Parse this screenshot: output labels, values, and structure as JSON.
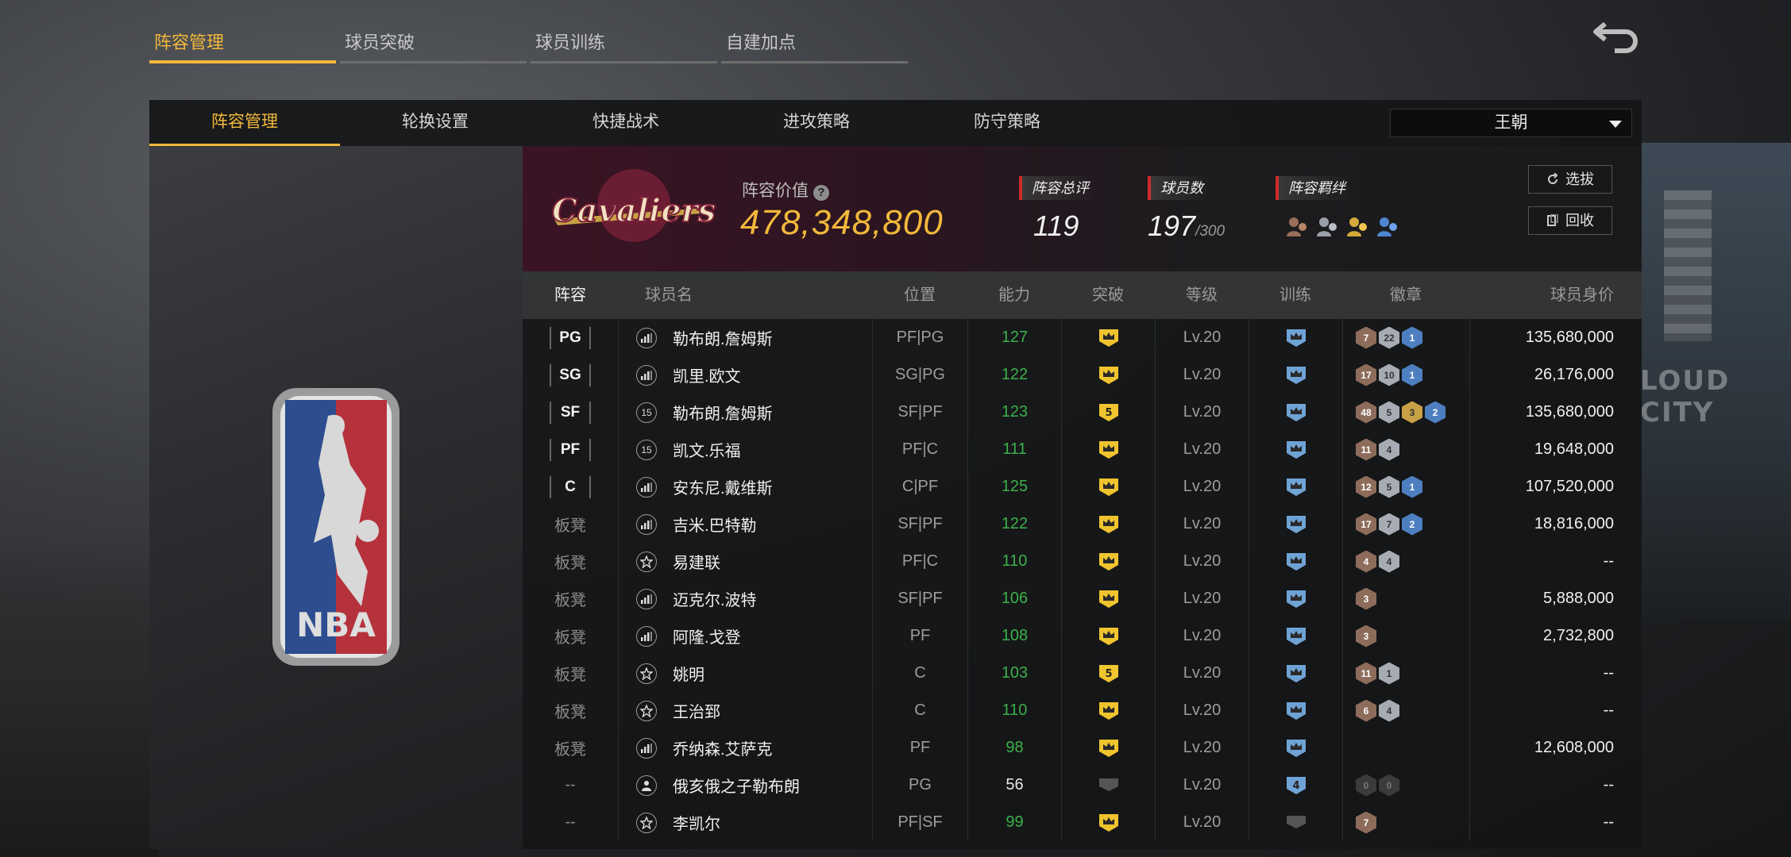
{
  "top_tabs": [
    "阵容管理",
    "球员突破",
    "球员训练",
    "自建加点"
  ],
  "sub_tabs": [
    "阵容管理",
    "轮换设置",
    "快捷战术",
    "进攻策略",
    "防守策略"
  ],
  "dynasty": "王朝",
  "team": {
    "value_label": "阵容价值",
    "value": "478,348,800",
    "overall_label": "阵容总评",
    "overall": "119",
    "player_count_label": "球员数",
    "player_count": "197",
    "player_count_max": "/300",
    "bond_label": "阵容羁绊",
    "select_btn": "选拔",
    "recycle_btn": "回收",
    "bg_right_text": "LOUD CITY"
  },
  "table": {
    "headers": [
      "阵容",
      "球员名",
      "位置",
      "能力",
      "突破",
      "等级",
      "训练",
      "徽章",
      "球员身价"
    ],
    "rows": [
      {
        "slot": "PG",
        "icon": "bars",
        "name": "勒布朗.詹姆斯",
        "pos": "PF|PG",
        "ability": "127",
        "break": "crown",
        "level": "Lv.20",
        "train": "crown",
        "badges": [
          [
            "bronze",
            "7"
          ],
          [
            "silver",
            "22"
          ],
          [
            "blue",
            "1"
          ]
        ],
        "price": "135,680,000"
      },
      {
        "slot": "SG",
        "icon": "bars",
        "name": "凯里.欧文",
        "pos": "SG|PG",
        "ability": "122",
        "break": "crown",
        "level": "Lv.20",
        "train": "crown",
        "badges": [
          [
            "bronze",
            "17"
          ],
          [
            "silver",
            "10"
          ],
          [
            "blue",
            "1"
          ]
        ],
        "price": "26,176,000"
      },
      {
        "slot": "SF",
        "icon": "15",
        "name": "勒布朗.詹姆斯",
        "pos": "SF|PF",
        "ability": "123",
        "break": "5",
        "level": "Lv.20",
        "train": "crown",
        "badges": [
          [
            "bronze",
            "48"
          ],
          [
            "silver",
            "5"
          ],
          [
            "gold",
            "3"
          ],
          [
            "blue",
            "2"
          ]
        ],
        "price": "135,680,000"
      },
      {
        "slot": "PF",
        "icon": "15",
        "name": "凯文.乐福",
        "pos": "PF|C",
        "ability": "111",
        "break": "crown",
        "level": "Lv.20",
        "train": "crown",
        "badges": [
          [
            "bronze",
            "11"
          ],
          [
            "silver",
            "4"
          ]
        ],
        "price": "19,648,000"
      },
      {
        "slot": "C",
        "icon": "bars",
        "name": "安东尼.戴维斯",
        "pos": "C|PF",
        "ability": "125",
        "break": "crown",
        "level": "Lv.20",
        "train": "crown",
        "badges": [
          [
            "bronze",
            "12"
          ],
          [
            "silver",
            "5"
          ],
          [
            "blue",
            "1"
          ]
        ],
        "price": "107,520,000"
      },
      {
        "slot": "板凳",
        "icon": "bars",
        "name": "吉米.巴特勒",
        "pos": "SF|PF",
        "ability": "122",
        "break": "crown",
        "level": "Lv.20",
        "train": "crown",
        "badges": [
          [
            "bronze",
            "17"
          ],
          [
            "silver",
            "7"
          ],
          [
            "blue",
            "2"
          ]
        ],
        "price": "18,816,000"
      },
      {
        "slot": "板凳",
        "icon": "star",
        "name": "易建联",
        "pos": "PF|C",
        "ability": "110",
        "break": "crown",
        "level": "Lv.20",
        "train": "crown",
        "badges": [
          [
            "bronze",
            "4"
          ],
          [
            "silver",
            "4"
          ]
        ],
        "price": "--"
      },
      {
        "slot": "板凳",
        "icon": "bars",
        "name": "迈克尔.波特",
        "pos": "SF|PF",
        "ability": "106",
        "break": "crown",
        "level": "Lv.20",
        "train": "crown",
        "badges": [
          [
            "bronze",
            "3"
          ]
        ],
        "price": "5,888,000"
      },
      {
        "slot": "板凳",
        "icon": "bars",
        "name": "阿隆.戈登",
        "pos": "PF",
        "ability": "108",
        "break": "crown",
        "level": "Lv.20",
        "train": "crown",
        "badges": [
          [
            "bronze",
            "3"
          ]
        ],
        "price": "2,732,800"
      },
      {
        "slot": "板凳",
        "icon": "star",
        "name": "姚明",
        "pos": "C",
        "ability": "103",
        "break": "5",
        "level": "Lv.20",
        "train": "crown",
        "badges": [
          [
            "bronze",
            "11"
          ],
          [
            "silver",
            "1"
          ]
        ],
        "price": "--"
      },
      {
        "slot": "板凳",
        "icon": "star",
        "name": "王治郅",
        "pos": "C",
        "ability": "110",
        "break": "crown",
        "level": "Lv.20",
        "train": "crown",
        "badges": [
          [
            "bronze",
            "6"
          ],
          [
            "silver",
            "4"
          ]
        ],
        "price": "--"
      },
      {
        "slot": "板凳",
        "icon": "bars",
        "name": "乔纳森.艾萨克",
        "pos": "PF",
        "ability": "98",
        "break": "crown",
        "level": "Lv.20",
        "train": "crown",
        "badges": [],
        "price": "12,608,000"
      },
      {
        "slot": "--",
        "icon": "person",
        "name": "俄亥俄之子勒布朗",
        "pos": "PG",
        "ability": "56",
        "break": "empty",
        "level": "Lv.20",
        "train": "4",
        "badges": [
          [
            "dark",
            "0"
          ],
          [
            "dark",
            "0"
          ]
        ],
        "price": "--"
      },
      {
        "slot": "--",
        "icon": "star",
        "name": "李凯尔",
        "pos": "PF|SF",
        "ability": "99",
        "break": "crown",
        "level": "Lv.20",
        "train": "empty",
        "badges": [
          [
            "bronze",
            "7"
          ]
        ],
        "price": "--"
      }
    ]
  },
  "colors": {
    "accent": "#f2b83b",
    "ability_green": "#3bb04a",
    "badge_blue": "#4d7fc0"
  }
}
